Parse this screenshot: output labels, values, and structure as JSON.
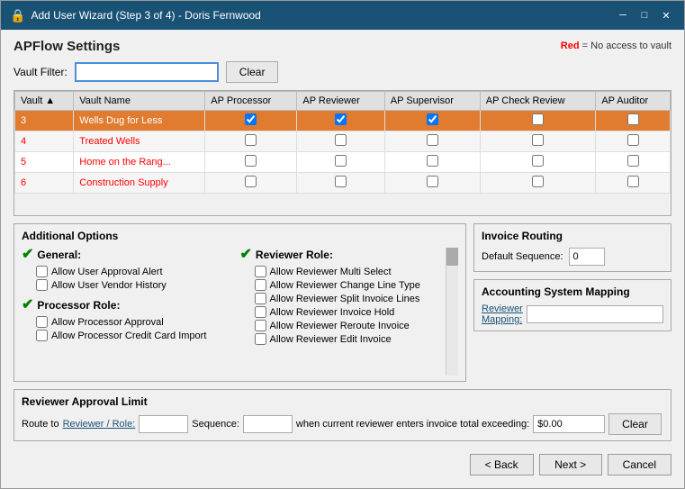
{
  "window": {
    "title": "Add User Wizard (Step 3 of 4) - Doris Fernwood",
    "icon": "🔒"
  },
  "page": {
    "title": "APFlow Settings",
    "legend": " = No access to vault",
    "legend_red": "Red"
  },
  "vault_filter": {
    "label": "Vault Filter:",
    "value": "",
    "placeholder": "",
    "clear_label": "Clear"
  },
  "table": {
    "columns": [
      "Vault",
      "Vault Name",
      "AP Processor",
      "AP Reviewer",
      "AP Supervisor",
      "AP Check Review",
      "AP Auditor"
    ],
    "rows": [
      {
        "id": "3",
        "name": "Wells Dug for Less",
        "selected": true,
        "ap_processor": true,
        "ap_reviewer": true,
        "ap_supervisor": true,
        "ap_check_review": false,
        "ap_auditor": false
      },
      {
        "id": "4",
        "name": "Treated Wells",
        "selected": false,
        "ap_processor": false,
        "ap_reviewer": false,
        "ap_supervisor": false,
        "ap_check_review": false,
        "ap_auditor": false
      },
      {
        "id": "5",
        "name": "Home on the Rang...",
        "selected": false,
        "ap_processor": false,
        "ap_reviewer": false,
        "ap_supervisor": false,
        "ap_check_review": false,
        "ap_auditor": false
      },
      {
        "id": "6",
        "name": "Construction Supply",
        "selected": false,
        "ap_processor": false,
        "ap_reviewer": false,
        "ap_supervisor": false,
        "ap_check_review": false,
        "ap_auditor": false
      }
    ]
  },
  "additional_options": {
    "title": "Additional Options",
    "general": {
      "header": "General:",
      "options": [
        "Allow User Approval Alert",
        "Allow User Vendor History"
      ]
    },
    "processor_role": {
      "header": "Processor Role:",
      "options": [
        "Allow Processor Approval",
        "Allow Processor Credit Card Import"
      ]
    },
    "reviewer_role": {
      "header": "Reviewer Role:",
      "options": [
        "Allow Reviewer Multi Select",
        "Allow Reviewer Change Line Type",
        "Allow Reviewer Split Invoice Lines",
        "Allow Reviewer Invoice Hold",
        "Allow Reviewer Reroute Invoice",
        "Allow Reviewer Edit Invoice"
      ]
    }
  },
  "invoice_routing": {
    "title": "Invoice Routing",
    "default_sequence_label": "Default Sequence:",
    "default_sequence_value": "0"
  },
  "accounting_mapping": {
    "title": "Accounting System Mapping",
    "link_label": "Reviewer Mapping:",
    "value": ""
  },
  "reviewer_approval": {
    "title": "Reviewer Approval Limit",
    "route_to_label": "Route to",
    "link_label": "Reviewer / Role:",
    "sequence_label": "Sequence:",
    "when_label": "when current reviewer enters invoice total exceeding:",
    "amount_value": "$0.00",
    "clear_label": "Clear"
  },
  "footer": {
    "back_label": "< Back",
    "next_label": "Next >",
    "cancel_label": "Cancel"
  }
}
